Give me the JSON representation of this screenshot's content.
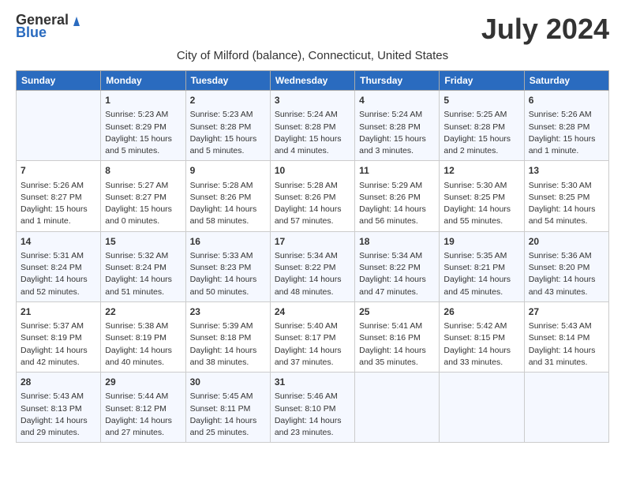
{
  "logo": {
    "general": "General",
    "blue": "Blue"
  },
  "title": "July 2024",
  "subtitle": "City of Milford (balance), Connecticut, United States",
  "days_of_week": [
    "Sunday",
    "Monday",
    "Tuesday",
    "Wednesday",
    "Thursday",
    "Friday",
    "Saturday"
  ],
  "weeks": [
    [
      {
        "day": "",
        "info": ""
      },
      {
        "day": "1",
        "info": "Sunrise: 5:23 AM\nSunset: 8:29 PM\nDaylight: 15 hours\nand 5 minutes."
      },
      {
        "day": "2",
        "info": "Sunrise: 5:23 AM\nSunset: 8:28 PM\nDaylight: 15 hours\nand 5 minutes."
      },
      {
        "day": "3",
        "info": "Sunrise: 5:24 AM\nSunset: 8:28 PM\nDaylight: 15 hours\nand 4 minutes."
      },
      {
        "day": "4",
        "info": "Sunrise: 5:24 AM\nSunset: 8:28 PM\nDaylight: 15 hours\nand 3 minutes."
      },
      {
        "day": "5",
        "info": "Sunrise: 5:25 AM\nSunset: 8:28 PM\nDaylight: 15 hours\nand 2 minutes."
      },
      {
        "day": "6",
        "info": "Sunrise: 5:26 AM\nSunset: 8:28 PM\nDaylight: 15 hours\nand 1 minute."
      }
    ],
    [
      {
        "day": "7",
        "info": "Sunrise: 5:26 AM\nSunset: 8:27 PM\nDaylight: 15 hours\nand 1 minute."
      },
      {
        "day": "8",
        "info": "Sunrise: 5:27 AM\nSunset: 8:27 PM\nDaylight: 15 hours\nand 0 minutes."
      },
      {
        "day": "9",
        "info": "Sunrise: 5:28 AM\nSunset: 8:26 PM\nDaylight: 14 hours\nand 58 minutes."
      },
      {
        "day": "10",
        "info": "Sunrise: 5:28 AM\nSunset: 8:26 PM\nDaylight: 14 hours\nand 57 minutes."
      },
      {
        "day": "11",
        "info": "Sunrise: 5:29 AM\nSunset: 8:26 PM\nDaylight: 14 hours\nand 56 minutes."
      },
      {
        "day": "12",
        "info": "Sunrise: 5:30 AM\nSunset: 8:25 PM\nDaylight: 14 hours\nand 55 minutes."
      },
      {
        "day": "13",
        "info": "Sunrise: 5:30 AM\nSunset: 8:25 PM\nDaylight: 14 hours\nand 54 minutes."
      }
    ],
    [
      {
        "day": "14",
        "info": "Sunrise: 5:31 AM\nSunset: 8:24 PM\nDaylight: 14 hours\nand 52 minutes."
      },
      {
        "day": "15",
        "info": "Sunrise: 5:32 AM\nSunset: 8:24 PM\nDaylight: 14 hours\nand 51 minutes."
      },
      {
        "day": "16",
        "info": "Sunrise: 5:33 AM\nSunset: 8:23 PM\nDaylight: 14 hours\nand 50 minutes."
      },
      {
        "day": "17",
        "info": "Sunrise: 5:34 AM\nSunset: 8:22 PM\nDaylight: 14 hours\nand 48 minutes."
      },
      {
        "day": "18",
        "info": "Sunrise: 5:34 AM\nSunset: 8:22 PM\nDaylight: 14 hours\nand 47 minutes."
      },
      {
        "day": "19",
        "info": "Sunrise: 5:35 AM\nSunset: 8:21 PM\nDaylight: 14 hours\nand 45 minutes."
      },
      {
        "day": "20",
        "info": "Sunrise: 5:36 AM\nSunset: 8:20 PM\nDaylight: 14 hours\nand 43 minutes."
      }
    ],
    [
      {
        "day": "21",
        "info": "Sunrise: 5:37 AM\nSunset: 8:19 PM\nDaylight: 14 hours\nand 42 minutes."
      },
      {
        "day": "22",
        "info": "Sunrise: 5:38 AM\nSunset: 8:19 PM\nDaylight: 14 hours\nand 40 minutes."
      },
      {
        "day": "23",
        "info": "Sunrise: 5:39 AM\nSunset: 8:18 PM\nDaylight: 14 hours\nand 38 minutes."
      },
      {
        "day": "24",
        "info": "Sunrise: 5:40 AM\nSunset: 8:17 PM\nDaylight: 14 hours\nand 37 minutes."
      },
      {
        "day": "25",
        "info": "Sunrise: 5:41 AM\nSunset: 8:16 PM\nDaylight: 14 hours\nand 35 minutes."
      },
      {
        "day": "26",
        "info": "Sunrise: 5:42 AM\nSunset: 8:15 PM\nDaylight: 14 hours\nand 33 minutes."
      },
      {
        "day": "27",
        "info": "Sunrise: 5:43 AM\nSunset: 8:14 PM\nDaylight: 14 hours\nand 31 minutes."
      }
    ],
    [
      {
        "day": "28",
        "info": "Sunrise: 5:43 AM\nSunset: 8:13 PM\nDaylight: 14 hours\nand 29 minutes."
      },
      {
        "day": "29",
        "info": "Sunrise: 5:44 AM\nSunset: 8:12 PM\nDaylight: 14 hours\nand 27 minutes."
      },
      {
        "day": "30",
        "info": "Sunrise: 5:45 AM\nSunset: 8:11 PM\nDaylight: 14 hours\nand 25 minutes."
      },
      {
        "day": "31",
        "info": "Sunrise: 5:46 AM\nSunset: 8:10 PM\nDaylight: 14 hours\nand 23 minutes."
      },
      {
        "day": "",
        "info": ""
      },
      {
        "day": "",
        "info": ""
      },
      {
        "day": "",
        "info": ""
      }
    ]
  ]
}
